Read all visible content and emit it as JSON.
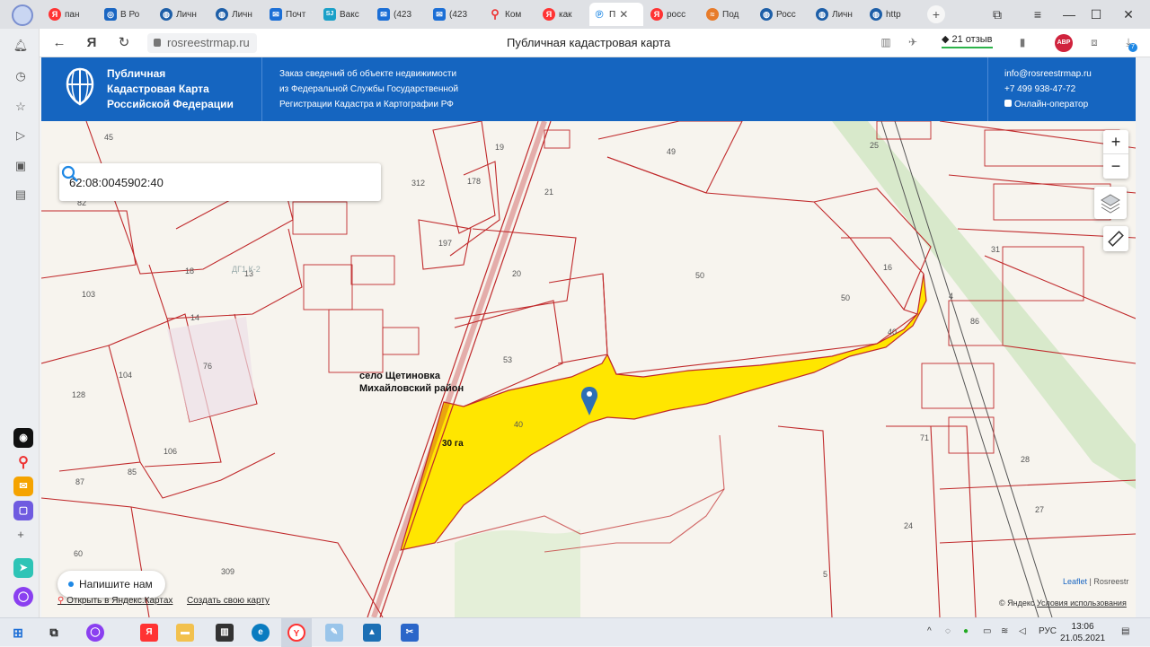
{
  "browser": {
    "tabs": [
      {
        "label": "пан",
        "icon": "yandex-icon",
        "active": false
      },
      {
        "label": "В Ро",
        "icon": "app-icon",
        "active": false
      },
      {
        "label": "Личн",
        "icon": "globe-icon",
        "active": false
      },
      {
        "label": "Личн",
        "icon": "globe-icon",
        "active": false
      },
      {
        "label": "Почт",
        "icon": "mail-icon",
        "active": false
      },
      {
        "label": "Вакс",
        "icon": "sj-icon",
        "active": false
      },
      {
        "label": "(423",
        "icon": "mail-icon",
        "active": false
      },
      {
        "label": "(423",
        "icon": "mail-icon",
        "active": false
      },
      {
        "label": "Ком",
        "icon": "map-pin-icon",
        "active": false
      },
      {
        "label": "как",
        "icon": "yandex-icon",
        "active": false
      },
      {
        "label": "П",
        "icon": "p-icon",
        "active": true
      },
      {
        "label": "росс",
        "icon": "yandex-icon",
        "active": false
      },
      {
        "label": "Под",
        "icon": "wave-icon",
        "active": false
      },
      {
        "label": "Росс",
        "icon": "globe-icon",
        "active": false
      },
      {
        "label": "Личн",
        "icon": "globe-icon",
        "active": false
      },
      {
        "label": "http",
        "icon": "globe-icon",
        "active": false
      }
    ],
    "address": "rosreestrmap.ru",
    "page_title": "Публичная кадастровая карта",
    "reviews": "21 отзыв",
    "abp": "ABP",
    "downloads_badge": "7"
  },
  "site": {
    "logo_lines": [
      "Публичная",
      "Кадастровая Карта",
      "Российской Федерации"
    ],
    "order_lines": [
      "Заказ сведений об объекте недвижимости",
      "из Федеральной Службы Государственной",
      "Регистрации Кадастра и Картографии РФ"
    ],
    "email": "info@rosreestrmap.ru",
    "phone": "+7 499 938-47-72",
    "online": "Онлайн-оператор",
    "accent": "#1565c0"
  },
  "map": {
    "search_value": "62:08:0045902:40",
    "caption_village": "село Щетиновка",
    "caption_district": "Михайловский район",
    "area_label": "30 га",
    "highlight_color": "#ffe600",
    "boundary_color": "#c0292b",
    "parcel_labels": [
      "45",
      "82",
      "19",
      "178",
      "312",
      "21",
      "49",
      "25",
      "197",
      "20",
      "50",
      "16",
      "50",
      "103",
      "13",
      "18",
      "14",
      "76",
      "104",
      "128",
      "53",
      "40",
      "40",
      "31",
      "86",
      "85",
      "106",
      "87",
      "71",
      "28",
      "27",
      "24",
      "60",
      "309",
      "5",
      "4"
    ],
    "area_small_label": "ДГ1 К-2",
    "zoom_in": "+",
    "zoom_out": "−",
    "chat": "Напишите нам",
    "open_yandex": "Открыть в Яндекс.Картах",
    "create_map": "Создать свою карту",
    "attribution_leaflet": "Leaflet",
    "attribution_rest": " | Rosreestr",
    "copyright": "© Яндекс",
    "terms": "Условия использования"
  },
  "taskbar": {
    "lang": "РУС",
    "time": "13:06",
    "date": "21.05.2021"
  }
}
